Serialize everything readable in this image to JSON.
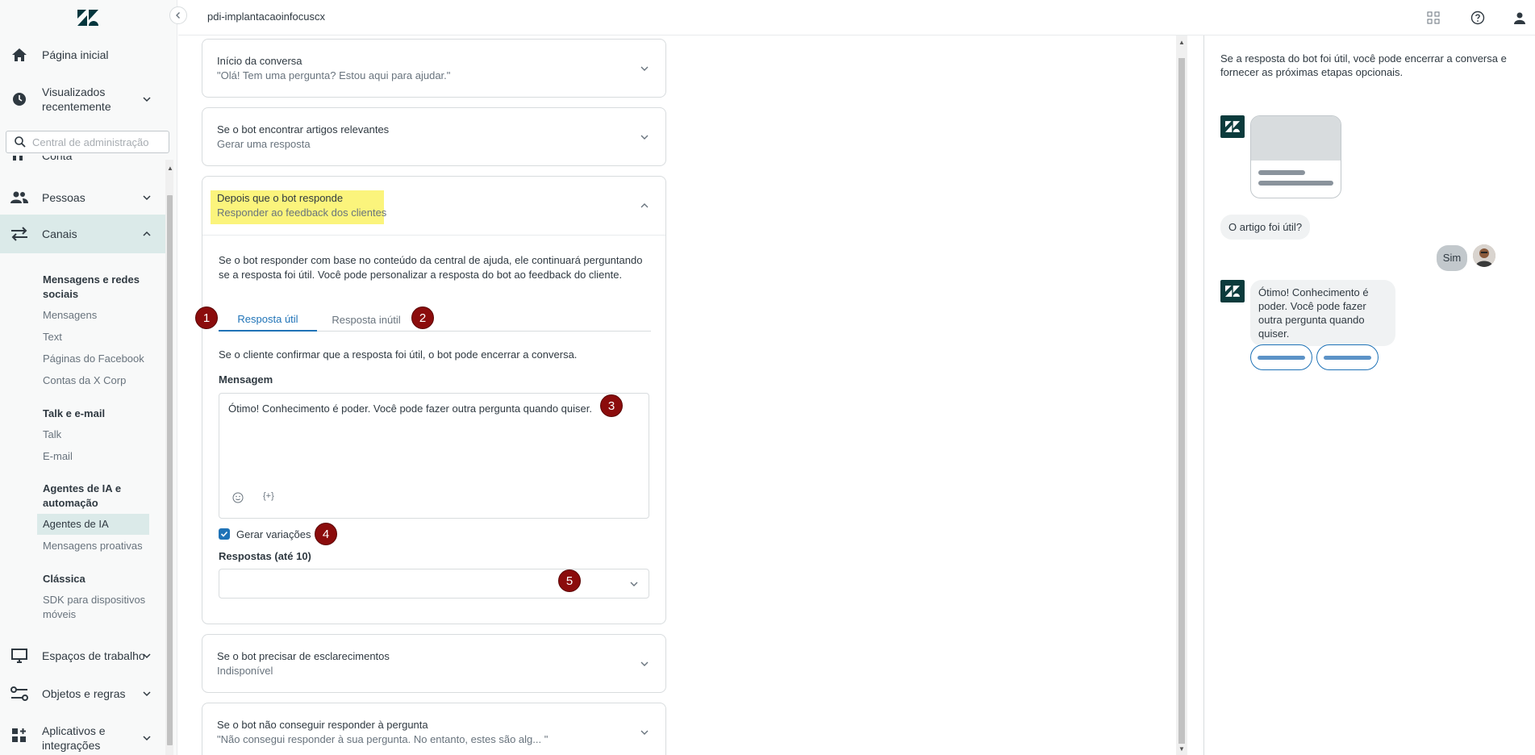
{
  "header": {
    "title": "pdi-implantacaoinfocuscx"
  },
  "search": {
    "placeholder": "Central de administração"
  },
  "sidebar": {
    "home": "Página inicial",
    "recent": "Visualizados recentemente",
    "hidden_item": "Conta",
    "people": "Pessoas",
    "channels": "Canais",
    "sections": [
      {
        "title": "Mensagens e redes sociais",
        "items": [
          "Mensagens",
          "Text",
          "Páginas do Facebook",
          "Contas da X Corp"
        ]
      },
      {
        "title": "Talk e e-mail",
        "items": [
          "Talk",
          "E-mail"
        ]
      },
      {
        "title": "Agentes de IA e automação",
        "items": [
          "Agentes de IA",
          "Mensagens proativas"
        ]
      },
      {
        "title": "Clássica",
        "items": [
          "SDK para dispositivos móveis"
        ]
      }
    ],
    "workspaces": "Espaços de trabalho",
    "objects": "Objetos e regras",
    "apps": "Aplicativos e integrações"
  },
  "cards": {
    "start": {
      "title": "Início da conversa",
      "subtitle": "\"Olá! Tem uma pergunta? Estou aqui para ajudar.\""
    },
    "articles": {
      "title": "Se o bot encontrar artigos relevantes",
      "subtitle": "Gerar uma resposta"
    },
    "after": {
      "title": "Depois que o bot responde",
      "subtitle": "Responder ao feedback dos clientes",
      "description": "Se o bot responder com base no conteúdo da central de ajuda, ele continuará perguntando se a resposta foi útil. Você pode personalizar a resposta do bot ao feedback do cliente.",
      "tabs": [
        "Resposta útil",
        "Resposta inútil"
      ],
      "tab_description": "Se o cliente confirmar que a resposta foi útil, o bot pode encerrar a conversa.",
      "message_label": "Mensagem",
      "message_value": "Ótimo! Conhecimento é poder. Você pode fazer outra pergunta quando quiser.",
      "checkbox_label": "Gerar variações",
      "checkbox_checked": true,
      "responses_label": "Respostas (até 10)",
      "responses_value": ""
    },
    "clarify": {
      "title": "Se o bot precisar de esclarecimentos",
      "subtitle": "Indisponível"
    },
    "cannot": {
      "title": "Se o bot não conseguir responder à pergunta",
      "subtitle": "\"Não consegui responder à sua pergunta. No entanto, estes são alg... \""
    }
  },
  "badges": [
    "1",
    "2",
    "3",
    "4",
    "5"
  ],
  "preview": {
    "intro": "Se a resposta do bot foi útil, você pode encerrar a conversa e fornecer as próximas etapas opcionais.",
    "question": "O artigo foi útil?",
    "user_reply": "Sim",
    "bot_reply": "Ótimo! Conhecimento é poder. Você pode fazer outra pergunta quando quiser."
  },
  "colors": {
    "accent": "#1f73b7",
    "active_nav": "#dbeae9",
    "highlight": "#fbf47c",
    "badge": "#8b0c0c",
    "brand_dark": "#0b3b3c"
  }
}
